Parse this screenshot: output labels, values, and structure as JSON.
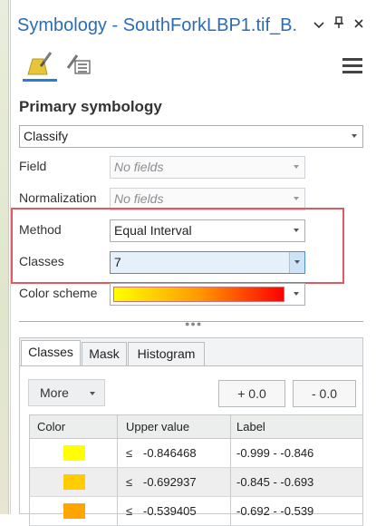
{
  "window": {
    "title": "Symbology - SouthForkLBP1.tif_B...",
    "buttons": [
      "chevron-down-icon",
      "pin-icon",
      "close-icon"
    ]
  },
  "tabs_icons": [
    "primary-symbology-brush-icon",
    "secondary-symbology-list-icon"
  ],
  "section": {
    "title": "Primary symbology"
  },
  "renderer": {
    "value": "Classify"
  },
  "field": {
    "label": "Field",
    "value": "No fields"
  },
  "normalization": {
    "label": "Normalization",
    "value": "No fields"
  },
  "method": {
    "label": "Method",
    "value": "Equal Interval"
  },
  "classes": {
    "label": "Classes",
    "value": "7"
  },
  "color_scheme": {
    "label": "Color scheme",
    "ramp": [
      "#ffff00",
      "#ff9900",
      "#ff0000"
    ]
  },
  "lower_tabs": [
    "Classes",
    "Mask",
    "Histogram"
  ],
  "actions": {
    "more": "More",
    "plus": "+ 0.0",
    "minus": "- 0.0"
  },
  "table": {
    "headers": [
      "Color",
      "Upper value",
      "Label"
    ],
    "rows": [
      {
        "color": "#ffff00",
        "op": "≤",
        "upper": "-0.846468",
        "label": "-0.999 - -0.846"
      },
      {
        "color": "#ffcc00",
        "op": "≤",
        "upper": "-0.692937",
        "label": "-0.845 - -0.693"
      },
      {
        "color": "#ffa500",
        "op": "≤",
        "upper": "-0.539405",
        "label": "-0.692 - -0.539"
      }
    ]
  },
  "highlight_color": "#e05a62",
  "accent_color": "#2b6cb3"
}
